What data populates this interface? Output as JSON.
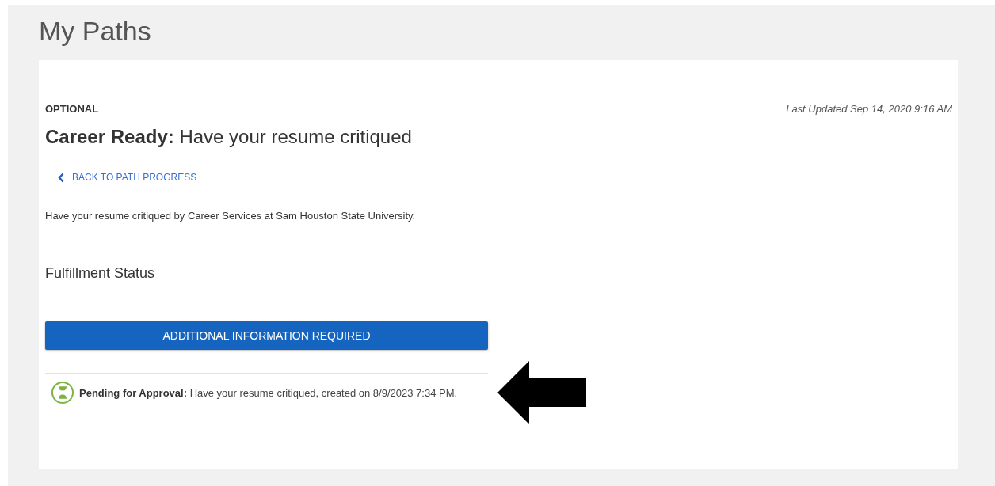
{
  "page": {
    "title": "My Paths"
  },
  "task": {
    "tag": "OPTIONAL",
    "last_updated": "Last Updated Sep 14, 2020 9:16 AM",
    "heading": "**Career Ready:** Have your resume critiqued",
    "back_link": "BACK TO PATH PROGRESS",
    "description": "Have your resume critiqued by Career Services at Sam Houston State University."
  },
  "fulfillment": {
    "title": "Fulfillment Status",
    "button": "ADDITIONAL INFORMATION REQUIRED",
    "entries": [
      {
        "kind": "pending",
        "text": "**Pending for Approval:** Have your resume critiqued, created on 8/9/2023 7:34 PM."
      }
    ]
  }
}
